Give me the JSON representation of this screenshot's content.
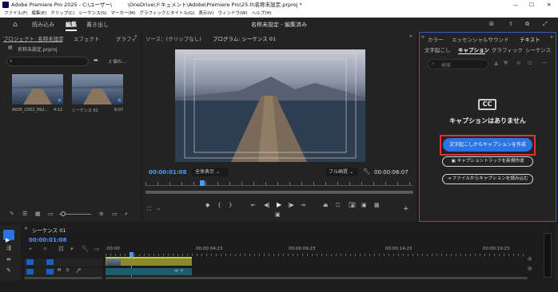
{
  "window": {
    "title": "Adobe Premiere Pro 2025 - C:\\ユーザー\\　　　\\OneDrive\\ドキュメント\\Adobe\\Premiere Pro\\25.0\\名称未設定.prproj *",
    "min": "—",
    "max": "☐",
    "close": "✕"
  },
  "menu": [
    "ファイル(F)",
    "編集(E)",
    "クリップ(C)",
    "シーケンス(S)",
    "マーカー(M)",
    "グラフィックとタイトル(G)",
    "表示(V)",
    "ウィンドウ(W)",
    "ヘルプ(H)"
  ],
  "workspace": {
    "tabs": [
      "読み込み",
      "編集",
      "書き出し"
    ],
    "active": "編集",
    "project_title": "名称未設定 - 編集済み"
  },
  "project_panel": {
    "tabs": [
      "プロジェクト: 名称未設定",
      "エフェクト",
      "グラフィ"
    ],
    "file": "名称未設定.prproj",
    "item_count": "2 個の...",
    "items": [
      {
        "name": "A005_C052_092...",
        "duration": "4:12"
      },
      {
        "name": "シーケンス 01",
        "duration": "6:07"
      }
    ]
  },
  "source_panel": {
    "tabs": [
      "ソース：(クリップなし)",
      "プログラム: シーケンス 01"
    ]
  },
  "program": {
    "timecode": "00:00:01:08",
    "fit": "全体表示",
    "quality": "フル画質",
    "duration": "00:00:06:07"
  },
  "right_panel": {
    "tabs": [
      "カラー",
      "エッセンシャルサウンド",
      "テキスト"
    ],
    "subtabs": [
      "文字起こし",
      "キャプション",
      "グラフィック",
      "シーケンス"
    ],
    "active_subtab": "キャプション",
    "search_placeholder": "検索",
    "cc_badge": "CC",
    "empty_message": "キャプションはありません",
    "btn_transcribe": "文字起こしからキャプションを作成",
    "btn_new_track": "キャプショントラックを新規作成",
    "btn_import": "ファイルからキャプションを読み込む"
  },
  "timeline": {
    "tab": "シーケンス 01",
    "timecode": "00:00:01:08",
    "ruler": [
      ":00:00",
      "00:00:04:23",
      "00:00:09:23",
      "00:00:14:23",
      "00:00:19:23"
    ],
    "v_label": "V1",
    "a_label": "A1"
  },
  "colors": {
    "accent": "#2a74e3",
    "highlight": "#e23434",
    "clip_video": "#8a8a2a",
    "clip_audio": "#1c5e6e"
  }
}
